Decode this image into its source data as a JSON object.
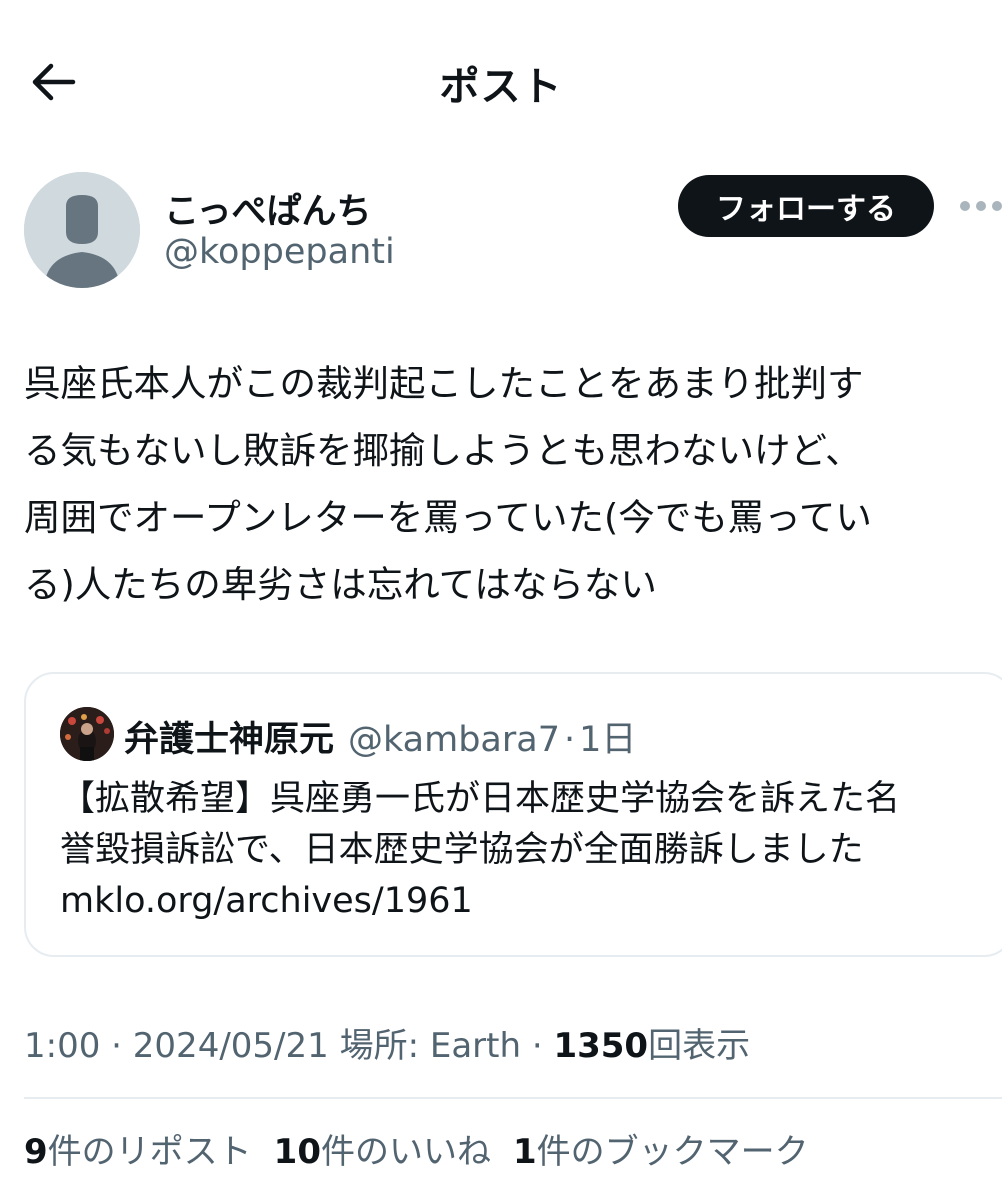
{
  "header": {
    "title": "ポスト"
  },
  "author": {
    "display_name": "こっぺぱんち",
    "handle": "@koppepanti",
    "follow_label": "フォローする"
  },
  "post": {
    "text": "呉座氏本人がこの裁判起こしたことをあまり批判す\nる気もないし敗訴を揶揄しようとも思わないけど、\n周囲でオープンレターを罵っていた(今でも罵ってい\nる)人たちの卑劣さは忘れてはならない"
  },
  "quote": {
    "display_name": "弁護士神原元",
    "handle": "@kambara7",
    "separator": "·",
    "time": "1日",
    "text": "【拡散希望】呉座勇一氏が日本歴史学協会を訴えた名\n誉毀損訴訟で、日本歴史学協会が全面勝訴しました",
    "link": "mklo.org/archives/1961"
  },
  "meta": {
    "time": "1:00",
    "sep1": " · ",
    "date": "2024/05/21",
    "location": " 場所: Earth",
    "sep2": " · ",
    "views_count": "1350",
    "views_label": "回表示"
  },
  "stats": {
    "reposts_count": "9",
    "reposts_label": "件のリポスト",
    "likes_count": "10",
    "likes_label": "件のいいね",
    "bookmarks_count": "1",
    "bookmarks_label": "件のブックマーク"
  },
  "icons": {
    "back": "back-arrow-icon",
    "more": "more-dots-icon",
    "default_avatar": "default-avatar-icon"
  },
  "colors": {
    "text_primary": "#0f1419",
    "text_secondary": "#536471",
    "follow_button_bg": "#0f1419",
    "border": "#e6ecf0"
  }
}
